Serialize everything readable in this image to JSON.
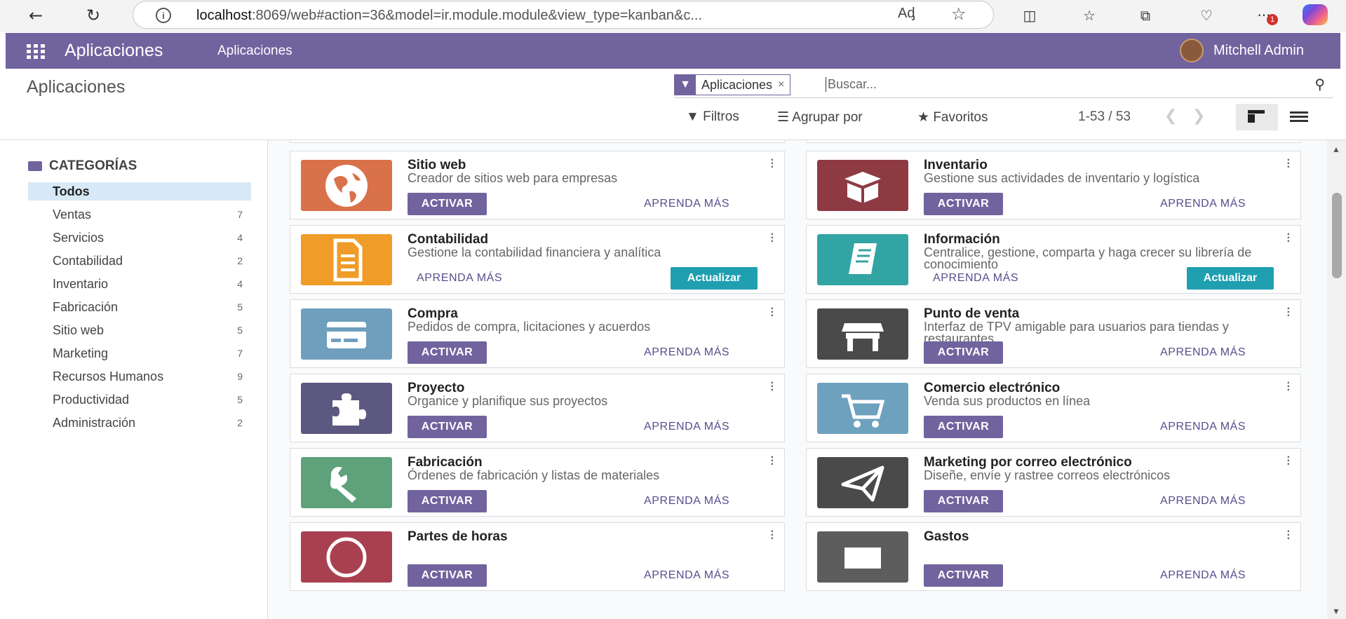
{
  "browser": {
    "url_host": "localhost",
    "url_rest": ":8069/web#action=36&model=ir.module.module&view_type=kanban&c...",
    "notification_count": "1"
  },
  "navbar": {
    "app_name": "Aplicaciones",
    "menu_item": "Aplicaciones",
    "user_name": "Mitchell Admin",
    "color": "#71639e"
  },
  "control": {
    "title": "Aplicaciones",
    "facet_label": "Aplicaciones",
    "search_placeholder": "Buscar...",
    "filters_label": "Filtros",
    "group_label": "Agrupar por",
    "favorites_label": "Favoritos",
    "pager": "1-53 / 53"
  },
  "sidebar": {
    "header": "CATEGORÍAS",
    "items": [
      {
        "label": "Todos",
        "count": ""
      },
      {
        "label": "Ventas",
        "count": "7"
      },
      {
        "label": "Servicios",
        "count": "4"
      },
      {
        "label": "Contabilidad",
        "count": "2"
      },
      {
        "label": "Inventario",
        "count": "4"
      },
      {
        "label": "Fabricación",
        "count": "5"
      },
      {
        "label": "Sitio web",
        "count": "5"
      },
      {
        "label": "Marketing",
        "count": "7"
      },
      {
        "label": "Recursos Humanos",
        "count": "9"
      },
      {
        "label": "Productividad",
        "count": "5"
      },
      {
        "label": "Administración",
        "count": "2"
      }
    ]
  },
  "labels": {
    "activate": "ACTIVAR",
    "learn_more": "APRENDA MÁS",
    "update": "Actualizar"
  },
  "apps": [
    {
      "name": "Sitio web",
      "desc": "Creador de sitios web para empresas",
      "icon": "globe-icon",
      "color": "#d9714a",
      "installed": false
    },
    {
      "name": "Inventario",
      "desc": "Gestione sus actividades de inventario y logística",
      "icon": "box-icon",
      "color": "#8e3a43",
      "installed": false
    },
    {
      "name": "Contabilidad",
      "desc": "Gestione la contabilidad financiera y analítica",
      "icon": "document-icon",
      "color": "#ef9c28",
      "installed": true
    },
    {
      "name": "Información",
      "desc": "Centralice, gestione, comparta y haga crecer su librería de conocimiento",
      "icon": "book-icon",
      "color": "#31a4a3",
      "installed": true
    },
    {
      "name": "Compra",
      "desc": "Pedidos de compra, licitaciones y acuerdos",
      "icon": "credit-card-icon",
      "color": "#6f9fbd",
      "installed": false
    },
    {
      "name": "Punto de venta",
      "desc": "Interfaz de TPV amigable para usuarios para tiendas y restaurantes",
      "icon": "store-icon",
      "color": "#4a4a4a",
      "installed": false
    },
    {
      "name": "Proyecto",
      "desc": "Organice y planifique sus proyectos",
      "icon": "puzzle-icon",
      "color": "#5d5881",
      "installed": false
    },
    {
      "name": "Comercio electrónico",
      "desc": "Venda sus productos en línea",
      "icon": "cart-icon",
      "color": "#6ea1be",
      "installed": false
    },
    {
      "name": "Fabricación",
      "desc": "Órdenes de fabricación y listas de materiales",
      "icon": "wrench-icon",
      "color": "#5fa17a",
      "installed": false
    },
    {
      "name": "Marketing por correo electrónico",
      "desc": "Diseñe, envíe y rastree correos electrónicos",
      "icon": "paper-plane-icon",
      "color": "#4a4a4a",
      "installed": false
    },
    {
      "name": "Partes de horas",
      "desc": "",
      "icon": "clock-icon",
      "color": "#a8404f",
      "installed": false
    },
    {
      "name": "Gastos",
      "desc": "",
      "icon": "money-icon",
      "color": "#5d5d5d",
      "installed": false
    }
  ]
}
